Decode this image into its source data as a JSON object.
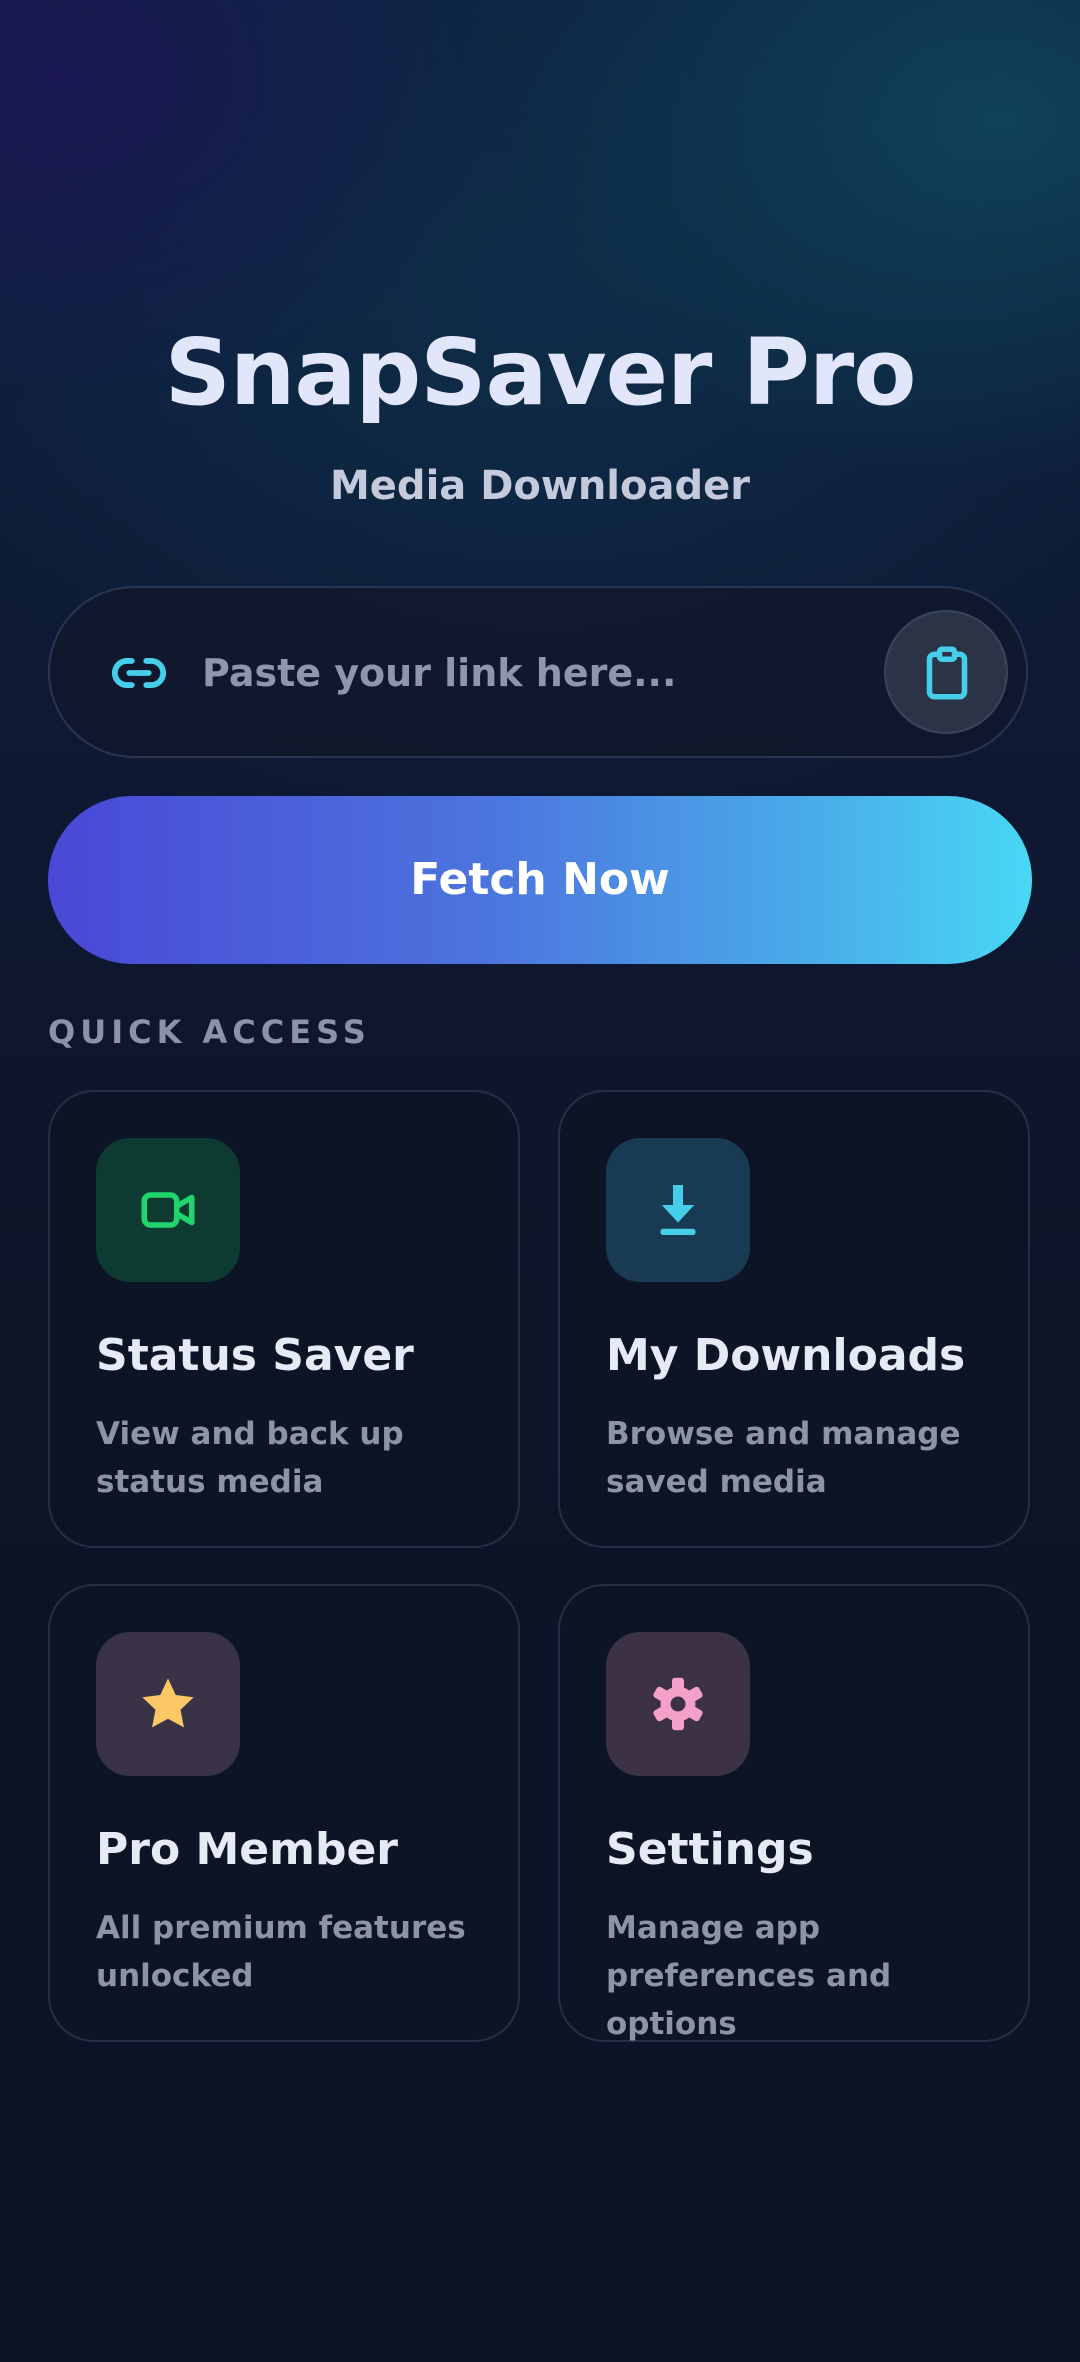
{
  "header": {
    "title": "SnapSaver Pro",
    "subtitle": "Media Downloader"
  },
  "url_bar": {
    "placeholder": "Paste your link here...",
    "value": "",
    "leading_icon": "link-icon",
    "paste_icon": "clipboard-icon"
  },
  "fetch_button": {
    "label": "Fetch Now"
  },
  "quick_access": {
    "label": "QUICK ACCESS",
    "cards": [
      {
        "title": "Status Saver",
        "description": "View and back up status media",
        "icon": "video-camera-icon",
        "icon_color": "#22d46e",
        "tile_color": "#0d3b31"
      },
      {
        "title": "My Downloads",
        "description": "Browse and manage saved media",
        "icon": "download-icon",
        "icon_color": "#46cdea",
        "tile_color": "#183a52"
      },
      {
        "title": "Pro Member",
        "description": "All premium features unlocked",
        "icon": "star-icon",
        "icon_color": "#fbc865",
        "tile_color": "#3a3347"
      },
      {
        "title": "Settings",
        "description": "Manage app preferences and options",
        "icon": "gear-icon",
        "icon_color": "#f5a0c8",
        "tile_color": "#3d3146"
      }
    ]
  },
  "colors": {
    "accent_start": "#4a48d6",
    "accent_end": "#48d8f4",
    "background": "#0e1428"
  }
}
